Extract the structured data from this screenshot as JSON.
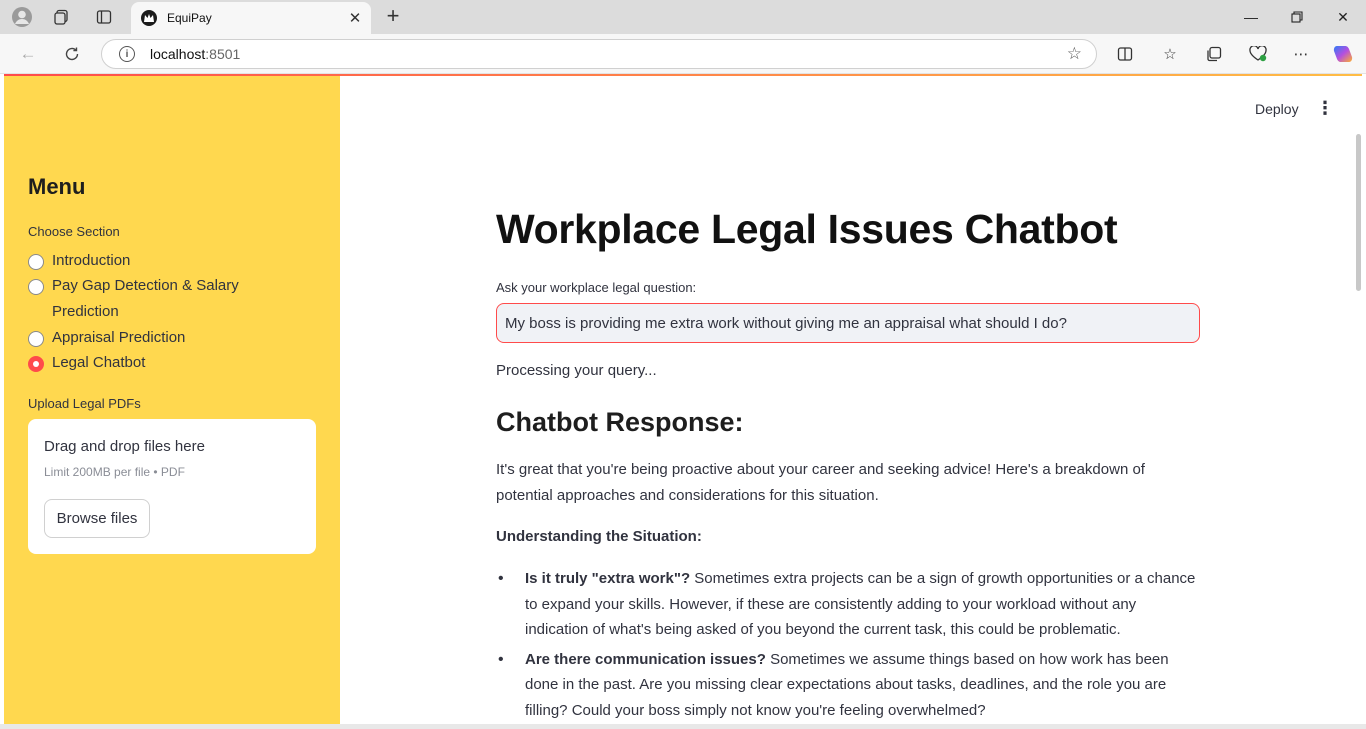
{
  "browser": {
    "tab_title": "EquiPay",
    "url_host": "localhost",
    "url_port": ":8501"
  },
  "sidebar": {
    "menu_title": "Menu",
    "section_label": "Choose Section",
    "options": [
      {
        "line1": "Introduction",
        "line2": "",
        "selected": false
      },
      {
        "line1": "Pay Gap Detection & Salary",
        "line2": "Prediction",
        "selected": false
      },
      {
        "line1": "Appraisal Prediction",
        "line2": "",
        "selected": false
      },
      {
        "line1": "Legal Chatbot",
        "line2": "",
        "selected": true
      }
    ],
    "upload_label": "Upload Legal PDFs",
    "uploader": {
      "drop_text": "Drag and drop files here",
      "limit_text": "Limit 200MB per file • PDF",
      "browse_label": "Browse files"
    }
  },
  "header": {
    "deploy_label": "Deploy",
    "menu_icon": "⋮"
  },
  "main": {
    "title": "Workplace Legal Issues Chatbot",
    "question_label": "Ask your workplace legal question:",
    "question_value": "My boss is providing me extra work without giving me an appraisal what should I do?",
    "processing": "Processing your query...",
    "response_title": "Chatbot Response:",
    "intro": "It's great that you're being proactive about your career and seeking advice! Here's a breakdown of potential approaches and considerations for this situation.",
    "section_heading": "Understanding the Situation:",
    "bullets": [
      {
        "bold": "Is it truly \"extra work\"?",
        "text": " Sometimes extra projects can be a sign of growth opportunities or a chance to expand your skills. However, if these are consistently adding to your workload without any indication of what's being asked of you beyond the current task, this could be problematic."
      },
      {
        "bold": "Are there communication issues?",
        "text": " Sometimes we assume things based on how work has been done in the past. Are you missing clear expectations about tasks, deadlines, and the role you are filling? Could your boss simply not know you're feeling overwhelmed?"
      }
    ]
  },
  "colors": {
    "sidebar_bg": "#ffd84f",
    "accent": "#ff4b4b",
    "text": "#31333f"
  }
}
